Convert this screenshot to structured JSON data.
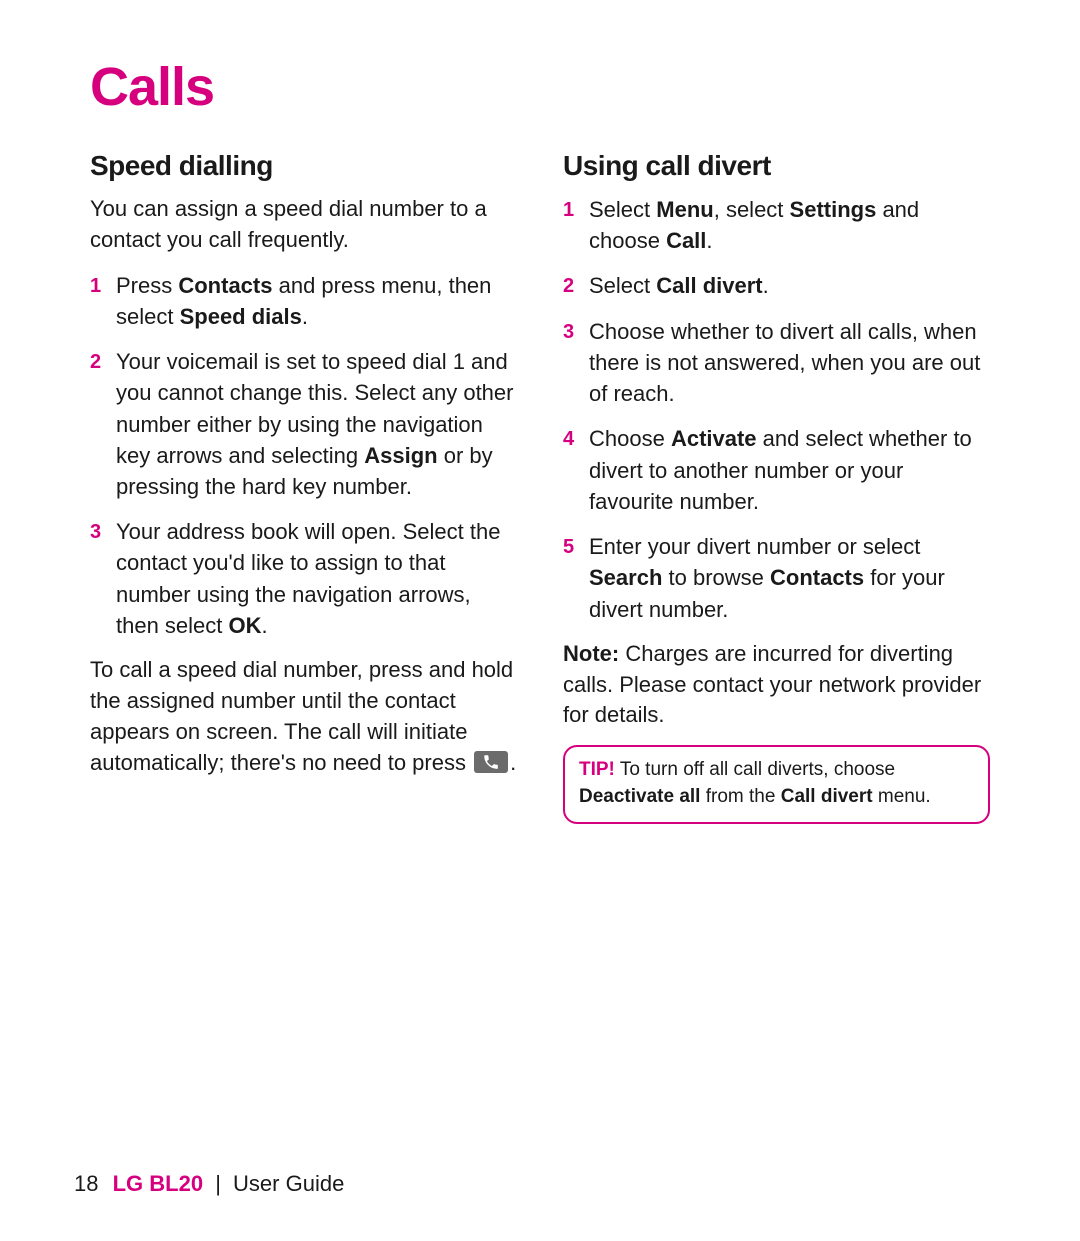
{
  "page_title": "Calls",
  "left": {
    "heading": "Speed dialling",
    "intro": "You can assign a speed dial number to a contact you call frequently.",
    "steps": [
      "Press <b>Contacts</b> and press menu, then select <b>Speed dials</b>.",
      "Your voicemail is set to speed dial 1 and you cannot change this. Select any other number either by using the navigation key arrows and selecting <b>Assign</b> or by pressing the hard key number.",
      "Your address book will open. Select the contact you'd like to assign to that number using the navigation arrows, then select <b>OK</b>."
    ],
    "outro_before_icon": "To call a speed dial number, press and hold the assigned number until the contact appears on screen. The call will initiate automatically; there's no need to press ",
    "outro_after_icon": "."
  },
  "right": {
    "heading": "Using call divert",
    "steps": [
      "Select <b>Menu</b>, select <b>Settings</b> and choose <b>Call</b>.",
      "Select <b>Call divert</b>.",
      "Choose whether to divert all calls, when there is not answered, when you are out of reach.",
      "Choose <b>Activate</b> and select whether to divert to another number or your favourite number.",
      "Enter your divert number or select <b>Search</b> to browse <b>Contacts</b> for your divert number."
    ],
    "note": "<b>Note:</b> Charges are incurred for diverting calls. Please contact your network provider for details.",
    "tip_label": "TIP!",
    "tip_text": " To turn off all call diverts, choose <b>Deactivate all</b> from the <b>Call divert</b> menu."
  },
  "footer": {
    "page_number": "18",
    "model": "LG BL20",
    "separator": "|",
    "guide": "User Guide"
  }
}
